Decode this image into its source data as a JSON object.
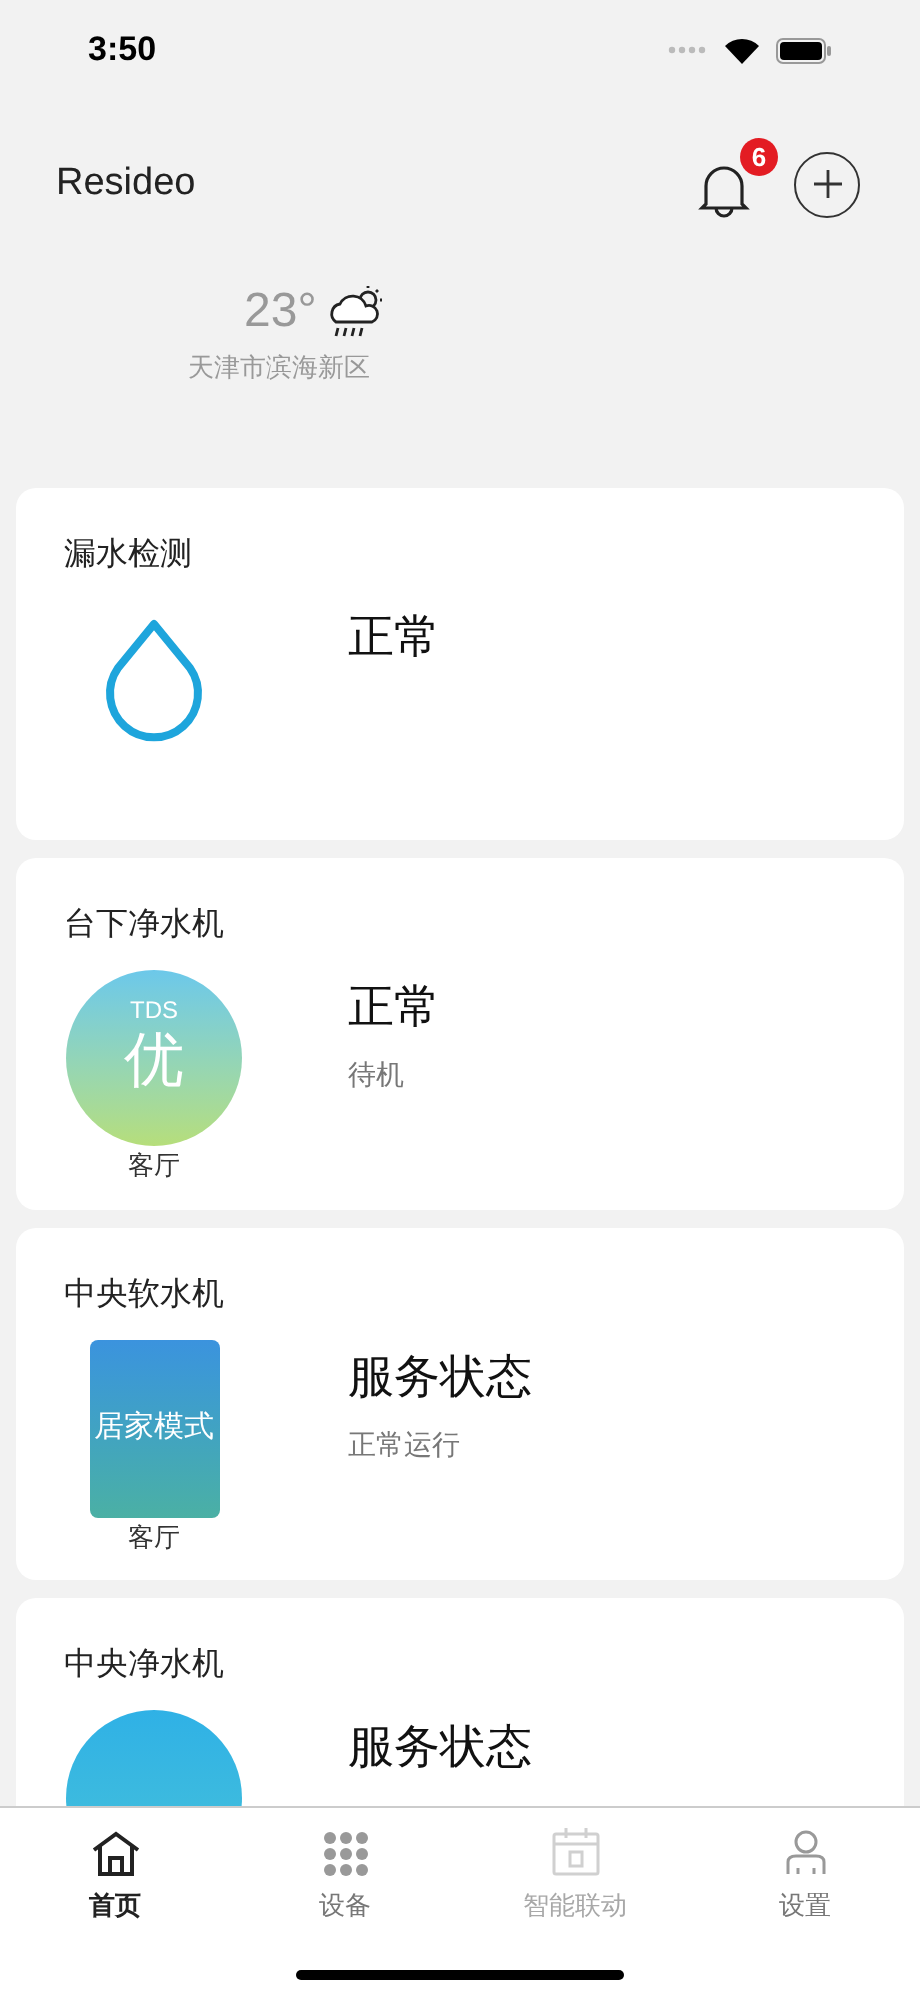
{
  "status_bar": {
    "time": "3:50"
  },
  "header": {
    "title": "Resideo",
    "notification_count": "6"
  },
  "weather": {
    "temperature": "23°",
    "location": "天津市滨海新区"
  },
  "devices": [
    {
      "kind": "drop",
      "name": "漏水检测",
      "status": "正常"
    },
    {
      "kind": "tds",
      "name": "台下净水机",
      "badge_label": "TDS",
      "badge_value": "优",
      "room": "客厅",
      "status": "正常",
      "detail": "待机"
    },
    {
      "kind": "mode-rect",
      "name": "中央软水机",
      "badge_value": "居家模式",
      "room": "客厅",
      "status": "服务状态",
      "detail": "正常运行"
    },
    {
      "kind": "mode-circle",
      "name": "中央净水机",
      "status": "服务状态"
    }
  ],
  "tabs": [
    {
      "kind": "home",
      "label": "首页",
      "selected": true,
      "disabled": false
    },
    {
      "kind": "grid",
      "label": "设备",
      "selected": false,
      "disabled": false
    },
    {
      "kind": "calendar",
      "label": "智能联动",
      "selected": false,
      "disabled": true
    },
    {
      "kind": "person",
      "label": "设置",
      "selected": false,
      "disabled": false
    }
  ]
}
